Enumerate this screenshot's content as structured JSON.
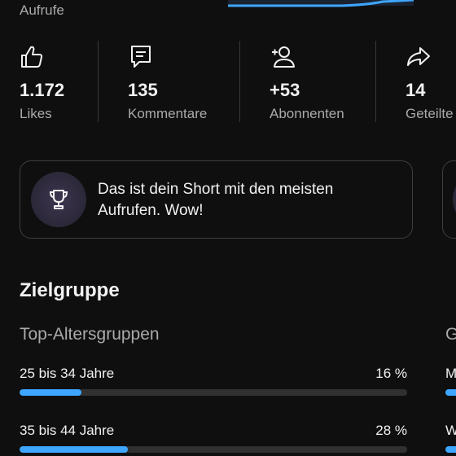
{
  "header": {
    "views_label": "Aufrufe",
    "chart_color": "#3ea6ff"
  },
  "stats": [
    {
      "icon": "thumbs-up-icon",
      "value": "1.172",
      "label": "Likes"
    },
    {
      "icon": "comment-icon",
      "value": "135",
      "label": "Kommentare"
    },
    {
      "icon": "add-person-icon",
      "value": "+53",
      "label": "Abonnenten"
    },
    {
      "icon": "share-icon",
      "value": "14",
      "label": "Geteilte"
    }
  ],
  "highlight_card": {
    "icon": "trophy-icon",
    "text": "Das ist dein Short mit den meisten Aufrufen. Wow!"
  },
  "audience": {
    "title": "Zielgruppe",
    "age_title": "Top-Altersgruppen",
    "next_title_peek": "G",
    "bar_color": "#3ea6ff",
    "age_groups": [
      {
        "label": "25 bis 34 Jahre",
        "percent_label": "16 %",
        "percent": 16
      },
      {
        "label": "35 bis 44 Jahre",
        "percent_label": "28 %",
        "percent": 28
      }
    ],
    "next_rows_peek": [
      "M",
      "W"
    ]
  }
}
